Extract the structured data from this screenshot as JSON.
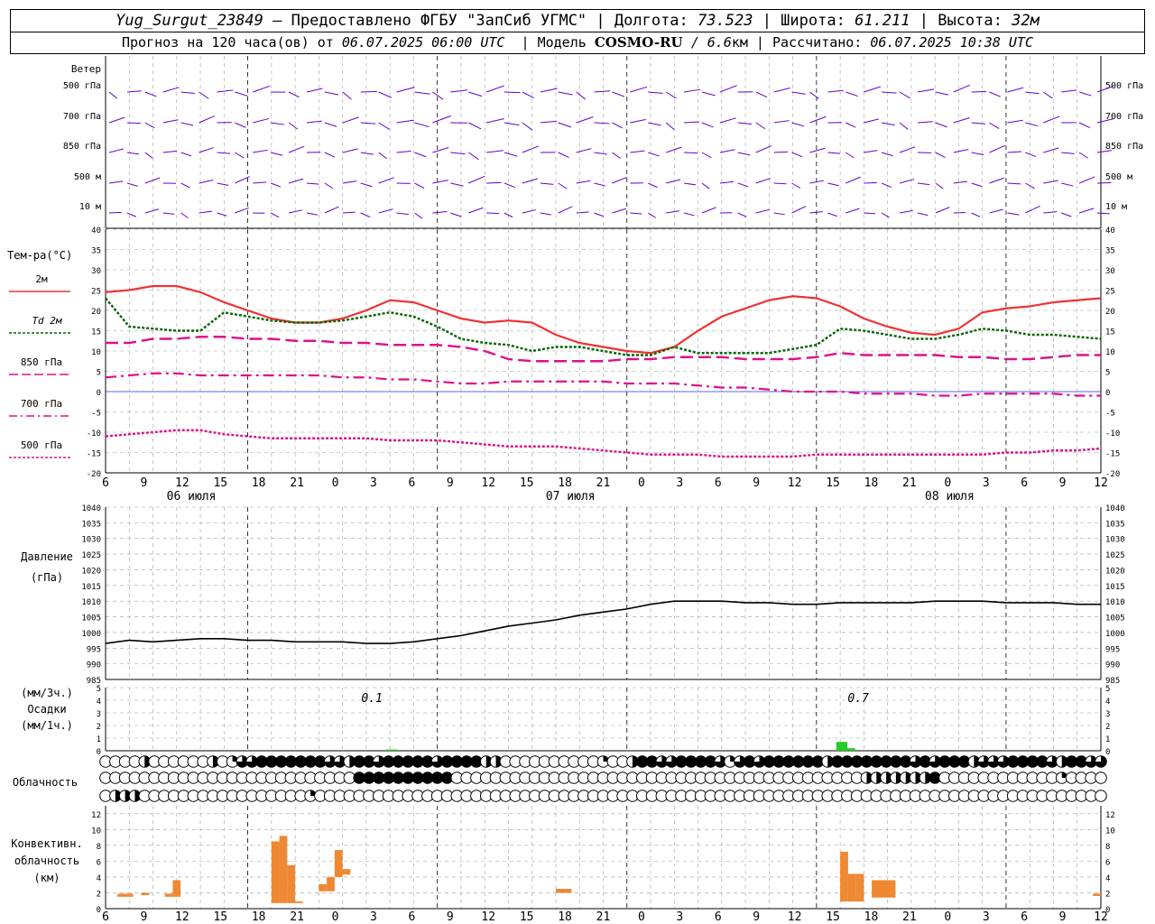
{
  "header": {
    "station": "Yug_Surgut_23849",
    "dash": "—",
    "provider": "Предоставлено ФГБУ \"ЗапСиб УГМС\"",
    "lon_label": "Долгота:",
    "lon": "73.523",
    "lat_label": "Широта:",
    "lat": "61.211",
    "alt_label": "Высота:",
    "alt": "32м",
    "forecast_prefix": "Прогноз на 120 часа(ов) от",
    "forecast_date": "06.07.2025 06:00 UTC",
    "model_label": "Модель",
    "model_name": "COSMO-RU",
    "model_res": "/ 6.6",
    "model_res_unit": "км",
    "calc_label": "Рассчитано:",
    "calc_date": "06.07.2025 10:38 UTC"
  },
  "colors": {
    "t2m": "#ee3333",
    "td2m": "#006600",
    "t850": "#dd1188",
    "wind": "#6600cc",
    "zero_line": "#3333ff",
    "pressure": "#000000",
    "precip": "#22cc22",
    "conv": "#ee8833",
    "grid": "#a0a0a0"
  },
  "chart_data": [
    {
      "type": "wind-barbs",
      "row_label": "Ветер",
      "levels": [
        "500 гПа",
        "700 гПа",
        "850 гПа",
        "500 м",
        "10 м"
      ],
      "speed_ms": [
        [
          8,
          8,
          10,
          10,
          10,
          12,
          12,
          12,
          12,
          10,
          10,
          10,
          12,
          12,
          14,
          15,
          15,
          15,
          15,
          14,
          14,
          14,
          14,
          13,
          13,
          13,
          12,
          12,
          12,
          12,
          12,
          12,
          12,
          12,
          12,
          11,
          11,
          11,
          11,
          11,
          11,
          11,
          12,
          12,
          12,
          12,
          10,
          10,
          10,
          10,
          10,
          10,
          10,
          10,
          10,
          10
        ],
        [
          8,
          8,
          8,
          8,
          8,
          8,
          10,
          10,
          10,
          10,
          10,
          10,
          10,
          10,
          12,
          14,
          15,
          16,
          16,
          16,
          16,
          15,
          14,
          13,
          13,
          13,
          12,
          12,
          10,
          10,
          10,
          10,
          10,
          10,
          10,
          10,
          10,
          10,
          10,
          10,
          8,
          8,
          8,
          10,
          10,
          10,
          10,
          10,
          10,
          10,
          10,
          10,
          10,
          10,
          10,
          10
        ],
        [
          6,
          6,
          6,
          6,
          6,
          6,
          8,
          8,
          8,
          8,
          8,
          8,
          8,
          8,
          8,
          8,
          8,
          10,
          10,
          12,
          14,
          14,
          12,
          10,
          10,
          10,
          8,
          8,
          8,
          8,
          8,
          8,
          8,
          8,
          8,
          8,
          8,
          8,
          8,
          8,
          6,
          6,
          6,
          8,
          8,
          8,
          8,
          8,
          8,
          8,
          8,
          8,
          8,
          8,
          8,
          8
        ],
        [
          6,
          6,
          6,
          6,
          6,
          6,
          6,
          6,
          6,
          6,
          6,
          6,
          6,
          6,
          8,
          8,
          8,
          8,
          10,
          10,
          10,
          10,
          8,
          8,
          8,
          8,
          6,
          6,
          6,
          6,
          6,
          6,
          6,
          6,
          6,
          6,
          6,
          6,
          6,
          6,
          6,
          6,
          6,
          6,
          6,
          6,
          6,
          6,
          6,
          6,
          8,
          8,
          8,
          8,
          8,
          8
        ],
        [
          4,
          4,
          4,
          4,
          4,
          4,
          4,
          4,
          4,
          4,
          4,
          4,
          4,
          4,
          6,
          6,
          6,
          6,
          8,
          8,
          6,
          6,
          4,
          4,
          4,
          4,
          4,
          4,
          4,
          4,
          4,
          4,
          4,
          4,
          4,
          4,
          4,
          4,
          4,
          4,
          4,
          4,
          4,
          4,
          4,
          4,
          4,
          4,
          4,
          4,
          6,
          6,
          6,
          6,
          6,
          6
        ]
      ]
    },
    {
      "type": "line",
      "ylabel": "Тем-ра(°C)",
      "ylim": [
        -20,
        40
      ],
      "yticks": [
        -20,
        -15,
        -10,
        -5,
        0,
        5,
        10,
        15,
        20,
        25,
        30,
        35,
        40
      ],
      "x_hours_from_start": [
        0,
        3,
        6,
        9,
        12,
        15,
        18,
        21,
        24,
        27,
        30,
        33,
        36,
        39,
        42,
        45,
        48,
        51,
        54,
        57,
        60,
        63,
        66,
        69,
        72,
        75,
        78,
        81,
        84,
        87,
        90,
        93,
        96,
        99,
        102,
        105,
        108,
        111,
        114,
        117,
        120,
        123,
        126
      ],
      "series": [
        {
          "name": "2м",
          "style": "solid",
          "values": [
            24.5,
            25,
            26,
            26,
            24.5,
            22,
            20,
            18,
            17,
            17,
            18,
            20,
            22.5,
            22,
            20,
            18,
            17,
            17.5,
            17,
            14,
            12,
            11,
            10,
            9.5,
            11,
            15,
            18.5,
            20.5,
            22.5,
            23.5,
            23,
            21,
            18,
            16,
            14.5,
            14,
            15.5,
            19.5,
            20.5,
            21,
            22,
            22.5,
            23
          ]
        },
        {
          "name": "Td 2м",
          "style": "dotted",
          "values": [
            23,
            16,
            15.5,
            15,
            15,
            19.5,
            18.5,
            17.5,
            17,
            17,
            17.5,
            18.5,
            19.5,
            18.5,
            16,
            13,
            12,
            11.5,
            10,
            11,
            11,
            10,
            9,
            9,
            11,
            9.5,
            9.5,
            9.5,
            9.5,
            10.5,
            11.5,
            15.5,
            15,
            14,
            13,
            13,
            14,
            15.5,
            15,
            14,
            14,
            13.5,
            13
          ]
        },
        {
          "name": "850 гПа",
          "style": "dashed",
          "values": [
            12,
            12,
            13,
            13,
            13.5,
            13.5,
            13,
            13,
            12.5,
            12.5,
            12,
            12,
            11.5,
            11.5,
            11.5,
            11,
            10,
            8,
            7.5,
            7.5,
            7.5,
            7.5,
            8,
            8,
            8.5,
            8.5,
            8.5,
            8,
            8,
            8,
            8.5,
            9.5,
            9,
            9,
            9,
            9,
            8.5,
            8.5,
            8,
            8,
            8.5,
            9,
            9
          ]
        },
        {
          "name": "700 гПа",
          "style": "dashdot",
          "values": [
            3.5,
            4,
            4.5,
            4.5,
            4,
            4,
            4,
            4,
            4,
            4,
            3.5,
            3.5,
            3,
            3,
            2.5,
            2,
            2,
            2.5,
            2.5,
            2.5,
            2.5,
            2.5,
            2,
            2,
            2,
            1.5,
            1,
            1,
            0.5,
            0,
            0,
            0,
            -0.5,
            -0.5,
            -0.5,
            -1,
            -1,
            -0.5,
            -0.5,
            -0.5,
            -0.5,
            -1,
            -1
          ]
        },
        {
          "name": "500 гПа",
          "style": "dotted",
          "values": [
            -11,
            -10.5,
            -10,
            -9.5,
            -9.5,
            -10.5,
            -11,
            -11.5,
            -11.5,
            -11.5,
            -11.5,
            -11.5,
            -12,
            -12,
            -12,
            -12.5,
            -13,
            -13.5,
            -13.5,
            -13.5,
            -14,
            -14.5,
            -15,
            -15.5,
            -15.5,
            -15.5,
            -16,
            -16,
            -16,
            -16,
            -15.5,
            -15.5,
            -15.5,
            -15.5,
            -15.5,
            -15.5,
            -15.5,
            -15.5,
            -15,
            -15,
            -14.5,
            -14.5,
            -14
          ]
        }
      ]
    },
    {
      "type": "line",
      "ylabel": "Давление",
      "yunit": "(гПа)",
      "ylim": [
        985,
        1040
      ],
      "yticks": [
        985,
        990,
        995,
        1000,
        1005,
        1010,
        1015,
        1020,
        1025,
        1030,
        1035,
        1040
      ],
      "x_hours_from_start": [
        0,
        3,
        6,
        9,
        12,
        15,
        18,
        21,
        24,
        27,
        30,
        33,
        36,
        39,
        42,
        45,
        48,
        51,
        54,
        57,
        60,
        63,
        66,
        69,
        72,
        75,
        78,
        81,
        84,
        87,
        90,
        93,
        96,
        99,
        102,
        105,
        108,
        111,
        114,
        117,
        120,
        123,
        126
      ],
      "series": [
        {
          "name": "pressure",
          "values": [
            996.5,
            997.5,
            997,
            997.5,
            998,
            998,
            997.5,
            997.5,
            997,
            997,
            997,
            996.5,
            996.5,
            997,
            998,
            999,
            1000.5,
            1002,
            1003,
            1004,
            1005.5,
            1006.5,
            1007.5,
            1009,
            1010,
            1010,
            1010,
            1009.5,
            1009.5,
            1009,
            1009,
            1009.5,
            1009.5,
            1009.5,
            1009.5,
            1010,
            1010,
            1010,
            1009.5,
            1009.5,
            1009.5,
            1009,
            1009
          ]
        }
      ]
    },
    {
      "type": "bar",
      "ylabel": "(мм/3ч.) Осадки (мм/1ч.)",
      "ylim": [
        0,
        5
      ],
      "yticks": [
        0,
        1,
        2,
        3,
        4,
        5
      ],
      "annotations": [
        "0.1",
        "0.7"
      ],
      "bars": [
        {
          "x_hours": 36,
          "value": 0.1
        },
        {
          "x_hours": 93,
          "value": 0.7
        },
        {
          "x_hours": 94,
          "value": 0.2
        }
      ]
    },
    {
      "type": "cloud-circles",
      "row_label": "Облачность",
      "levels": [
        "upper",
        "middle",
        "lower"
      ],
      "cover_eighths": [
        [
          0,
          0,
          0,
          0,
          4,
          0,
          0,
          0,
          0,
          0,
          0,
          4,
          0,
          2,
          6,
          6,
          8,
          8,
          8,
          8,
          8,
          8,
          8,
          6,
          6,
          4,
          8,
          8,
          6,
          8,
          8,
          8,
          8,
          8,
          6,
          8,
          8,
          8,
          8,
          4,
          4,
          0,
          0,
          0,
          0,
          0,
          0,
          0,
          0,
          0,
          0,
          2,
          0,
          0,
          4,
          8,
          8,
          6,
          6,
          8,
          8,
          8,
          8,
          6,
          2,
          6,
          8,
          6,
          8,
          8,
          8,
          8,
          8,
          8,
          4,
          8,
          8,
          8,
          8,
          8,
          8,
          8,
          8,
          6,
          8,
          6,
          8,
          8,
          8,
          4,
          6,
          6,
          6,
          8,
          8,
          8,
          8,
          6,
          4,
          8,
          8,
          6,
          6
        ],
        [
          0,
          0,
          0,
          0,
          0,
          0,
          0,
          0,
          0,
          0,
          0,
          0,
          0,
          0,
          0,
          0,
          0,
          0,
          0,
          0,
          0,
          0,
          0,
          0,
          0,
          0,
          8,
          8,
          8,
          8,
          8,
          8,
          8,
          8,
          8,
          8,
          0,
          0,
          0,
          0,
          0,
          0,
          0,
          0,
          0,
          0,
          0,
          0,
          0,
          0,
          0,
          0,
          0,
          0,
          0,
          0,
          0,
          0,
          0,
          0,
          0,
          0,
          0,
          0,
          0,
          0,
          0,
          0,
          0,
          0,
          0,
          0,
          0,
          0,
          0,
          0,
          0,
          0,
          4,
          4,
          4,
          4,
          4,
          4,
          4,
          8,
          0,
          0,
          0,
          0,
          0,
          0,
          0,
          0,
          0,
          0,
          0,
          0,
          2,
          0,
          0,
          0,
          0
        ],
        [
          0,
          4,
          4,
          4,
          0,
          0,
          0,
          0,
          0,
          0,
          0,
          0,
          0,
          0,
          0,
          0,
          0,
          0,
          0,
          0,
          0,
          2,
          0,
          0,
          0,
          0,
          0,
          0,
          0,
          0,
          0,
          0,
          0,
          0,
          0,
          0,
          0,
          0,
          0,
          0,
          0,
          0,
          0,
          0,
          0,
          0,
          0,
          0,
          0,
          0,
          0,
          0,
          0,
          0,
          0,
          0,
          0,
          0,
          0,
          0,
          0,
          0,
          0,
          0,
          0,
          0,
          0,
          0,
          0,
          0,
          0,
          0,
          0,
          0,
          0,
          0,
          0,
          0,
          0,
          0,
          0,
          0,
          0,
          0,
          0,
          0,
          0,
          0,
          0,
          0,
          0,
          0,
          0,
          0,
          0,
          0,
          0,
          0,
          0,
          0,
          0,
          0,
          0
        ]
      ]
    },
    {
      "type": "bar",
      "ylabel": "Конвективн. облачность (км)",
      "ylim": [
        0,
        13
      ],
      "yticks": [
        0,
        2,
        4,
        6,
        8,
        10,
        12
      ],
      "bars": [
        {
          "x_start_hours": 1.5,
          "x_end_hours": 3.5,
          "bottom": 1.5,
          "top": 1.9
        },
        {
          "x_start_hours": 4.5,
          "x_end_hours": 5.5,
          "bottom": 1.7,
          "top": 2.0
        },
        {
          "x_start_hours": 7.5,
          "x_end_hours": 8.5,
          "bottom": 1.5,
          "top": 1.9
        },
        {
          "x_start_hours": 8.5,
          "x_end_hours": 9.5,
          "bottom": 1.5,
          "top": 3.6
        },
        {
          "x_start_hours": 21,
          "x_end_hours": 22,
          "bottom": 0.7,
          "top": 8.5
        },
        {
          "x_start_hours": 22,
          "x_end_hours": 23,
          "bottom": 0.7,
          "top": 9.2
        },
        {
          "x_start_hours": 23,
          "x_end_hours": 24,
          "bottom": 0.7,
          "top": 5.5
        },
        {
          "x_start_hours": 24,
          "x_end_hours": 25,
          "bottom": 0.7,
          "top": 0.9
        },
        {
          "x_start_hours": 27,
          "x_end_hours": 28,
          "bottom": 2.2,
          "top": 3.1
        },
        {
          "x_start_hours": 28,
          "x_end_hours": 29,
          "bottom": 2.2,
          "top": 4.0
        },
        {
          "x_start_hours": 29,
          "x_end_hours": 30,
          "bottom": 4.0,
          "top": 7.4
        },
        {
          "x_start_hours": 30,
          "x_end_hours": 31,
          "bottom": 4.3,
          "top": 5.0
        },
        {
          "x_start_hours": 57,
          "x_end_hours": 59,
          "bottom": 2.0,
          "top": 2.5
        },
        {
          "x_start_hours": 93,
          "x_end_hours": 94,
          "bottom": 0.9,
          "top": 7.2
        },
        {
          "x_start_hours": 94,
          "x_end_hours": 95,
          "bottom": 0.9,
          "top": 4.4
        },
        {
          "x_start_hours": 95,
          "x_end_hours": 96,
          "bottom": 0.9,
          "top": 4.4
        },
        {
          "x_start_hours": 97,
          "x_end_hours": 100,
          "bottom": 1.4,
          "top": 3.6
        },
        {
          "x_start_hours": 125,
          "x_end_hours": 126,
          "bottom": 1.6,
          "top": 1.9
        }
      ]
    }
  ],
  "x_axis": {
    "tick_labels": [
      "6",
      "9",
      "12",
      "15",
      "18",
      "21",
      "0",
      "3",
      "6",
      "9",
      "12",
      "15",
      "18",
      "21",
      "0",
      "3",
      "6",
      "9",
      "12",
      "15",
      "18",
      "21",
      "0",
      "3",
      "6",
      "9",
      "12"
    ],
    "day_labels": [
      "06 июля",
      "07 июля",
      "08 июля"
    ]
  }
}
